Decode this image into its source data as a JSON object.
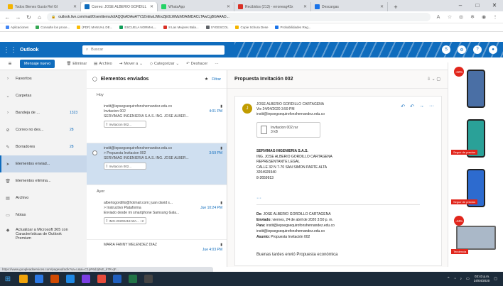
{
  "tabs": [
    {
      "label": "Todos Bienes Gusto Rel GI",
      "color": "#f4b400",
      "active": false
    },
    {
      "label": "Correo: JOSE ALBERIO GORDILL",
      "color": "#0f6cbd",
      "active": true
    },
    {
      "label": "WhatsApp",
      "color": "#25d366",
      "active": false
    },
    {
      "label": "Recibidos (213) - erroneag43x",
      "color": "#d93025",
      "active": false
    },
    {
      "label": "Descargas",
      "color": "#1a73e8",
      "active": false
    }
  ],
  "address_bar": {
    "url": "outlook.live.com/mail/0/sentitems/id/AQQkADAwATY3ZmEwLWExZjE0LWMzM0AtMDACLTAwCgBGAAAD..."
  },
  "bookmarks": [
    "Aplicaciones",
    "Consulte los proce...",
    "(PDF) MANUAL DE...",
    "ESCUELA NORMAL...",
    "8 Las Mejores Bala...",
    "SYGESCOL",
    "Copie Schura Dese",
    "Probabilidades Reg..."
  ],
  "outlook": {
    "brand": "Outlook",
    "search_placeholder": "Buscar",
    "new_message": "Mensaje nuevo",
    "commands": [
      "Eliminar",
      "Archivo",
      "Mover a",
      "Categorizar",
      "Deshacer",
      "···"
    ]
  },
  "nav": [
    {
      "label": "Favoritos",
      "count": "",
      "icon": "chevron-right-icon"
    },
    {
      "label": "Carpetas",
      "count": "",
      "icon": "chevron-down-icon"
    },
    {
      "label": "Bandeja de ...",
      "count": "1323",
      "icon": "inbox-icon"
    },
    {
      "label": "Correo no des...",
      "count": "28",
      "icon": "junk-icon"
    },
    {
      "label": "Borradores",
      "count": "28",
      "icon": "draft-icon"
    },
    {
      "label": "Elementos enviad...",
      "count": "",
      "icon": "sent-icon",
      "selected": true
    },
    {
      "label": "Elementos elimina...",
      "count": "",
      "icon": "trash-icon"
    },
    {
      "label": "Archivo",
      "count": "",
      "icon": "archive-icon"
    },
    {
      "label": "Notas",
      "count": "",
      "icon": "note-icon"
    },
    {
      "label": "Actualizar a Microsoft 365 con Características de Outlook Premium",
      "count": "",
      "icon": "diamond-icon"
    }
  ],
  "list": {
    "title": "Elementos enviados",
    "filter": "Filtrar",
    "groups": {
      "today": "Hoy",
      "yesterday": "Ayer"
    },
    "messages": [
      {
        "to": "instit@iepsegsequirofonshernandez.edu.co",
        "subject": "Invitacion 002",
        "time": "4:01 PM",
        "preview": "SERVIMAG INGENIERIA S.A.S. ING. JOSE ALBER...",
        "attachment": "Invitacion 002...",
        "selected": false
      },
      {
        "to": "instit@iepsegsequirofonshernandez.edu.co",
        "subject": "> Propuesta Invitacion 002",
        "time": "3:59 PM",
        "preview": "SERVIMAG INGENIERIA S.A.S. ING. JOSE ALBER...",
        "attachment": "Invitacion 002...",
        "selected": true
      },
      {
        "to": "albertogordillo@hotmail.com; juan david s...",
        "subject": "> Instructivo Plataforma",
        "time": "Jue 10:24 PM",
        "preview": "Enviado desde mi smartphone Samsung Gala...",
        "attachment": "IMG-20200418-WA...  +2",
        "selected": false
      },
      {
        "to": "MARIA FANNY MELENDEZ DIAZ",
        "subject": "",
        "time": "Jue 4:03 PM",
        "preview": "",
        "attachment": "",
        "selected": false
      }
    ]
  },
  "reading": {
    "subject": "Propuesta Invitación 002",
    "avatar": "J",
    "sender": "JOSE ALBERIO GORDILLO CARTAGENA",
    "date": "Vie 24/04/2020 3:59 PM",
    "to": "instit@iepsegsequirofonshernandez.edu.co",
    "attachment_name": "Invitacion 002.rar",
    "attachment_size": "3 kB",
    "signature": [
      "SERVIMAG INGENIERIA S.A.S.",
      "ING. JOSE ALBERIO GORDILLO CARTAGENA",
      "REPRESENTANTE LEGAL",
      "CALLE 32 N 7-70 SAN SIMON PARTE ALTA",
      "3204929340",
      "8-2659913"
    ],
    "forward": {
      "de_label": "De:",
      "de": "JOSE ALBERIO GORDILLO CARTAGENA",
      "enviado_label": "Enviado:",
      "enviado": "viernes, 24 de abril de 2020 3:50 p. m.",
      "para_label": "Para:",
      "para": "instit@iepsegsequirofonshernandez.edu.co",
      "cc": "instit@iepsegsequirofonshernandez.edu.co",
      "asunto_label": "Asunto:",
      "asunto": "Propuesta Invitación 002"
    },
    "body_start": "Buenas tardes envió Propuesta económica"
  },
  "ads": [
    {
      "tag": "",
      "badge": "-22%",
      "screen": "#4a6fa5"
    },
    {
      "tag": "Seguir de precios",
      "badge": "",
      "screen": "#2aa198"
    },
    {
      "tag": "Seguir de precios",
      "badge": "",
      "screen": "#2d6bcf"
    },
    {
      "tag": "Tendencia",
      "badge": "-44%",
      "screen": ""
    }
  ],
  "statusbar": "https://www.googleadservices.com/pagead/aclk?sa=L&ai=C1pP6dJj0vE_k7R-qF...",
  "taskbar": {
    "apps": [
      "#f0a30a",
      "#2b78e4",
      "#d04a02",
      "#1e88e5",
      "#7b3fe4",
      "#e74c3c",
      "#1f5fbf",
      "#217346",
      "#444444"
    ],
    "time": "03:43 p.m.",
    "date": "24/04/2020"
  }
}
